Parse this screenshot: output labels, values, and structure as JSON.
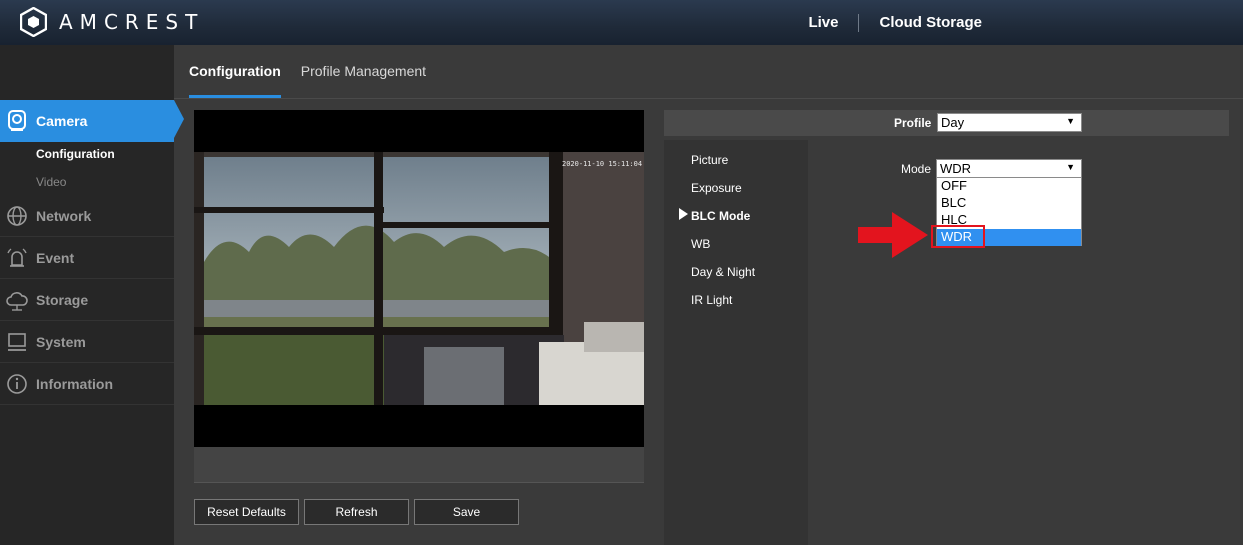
{
  "header": {
    "brand": "AMCREST",
    "nav": [
      {
        "label": "Live"
      },
      {
        "label": "Cloud Storage"
      }
    ]
  },
  "sidebar": {
    "items": [
      {
        "label": "Camera",
        "icon": "camera-icon",
        "active": true
      },
      {
        "label": "Network",
        "icon": "globe-icon"
      },
      {
        "label": "Event",
        "icon": "alarm-icon"
      },
      {
        "label": "Storage",
        "icon": "cloud-icon"
      },
      {
        "label": "System",
        "icon": "monitor-icon"
      },
      {
        "label": "Information",
        "icon": "info-icon"
      }
    ],
    "sub_items": [
      {
        "label": "Configuration",
        "active": true
      },
      {
        "label": "Video"
      }
    ]
  },
  "tabs": [
    {
      "label": "Configuration",
      "active": true
    },
    {
      "label": "Profile Management"
    }
  ],
  "video": {
    "timestamp": "2020-11-10 15:11:04"
  },
  "buttons": {
    "reset": "Reset Defaults",
    "refresh": "Refresh",
    "save": "Save"
  },
  "profile": {
    "label": "Profile",
    "value": "Day"
  },
  "menu": [
    {
      "label": "Picture"
    },
    {
      "label": "Exposure"
    },
    {
      "label": "BLC Mode",
      "active": true
    },
    {
      "label": "WB"
    },
    {
      "label": "Day & Night"
    },
    {
      "label": "IR Light"
    }
  ],
  "mode": {
    "label": "Mode",
    "value": "WDR",
    "options": [
      "OFF",
      "BLC",
      "HLC",
      "WDR"
    ],
    "selected": "WDR"
  },
  "colors": {
    "accent": "#2a8ee0",
    "highlight": "#e3141e",
    "dropdown_selected": "#3090f0"
  }
}
